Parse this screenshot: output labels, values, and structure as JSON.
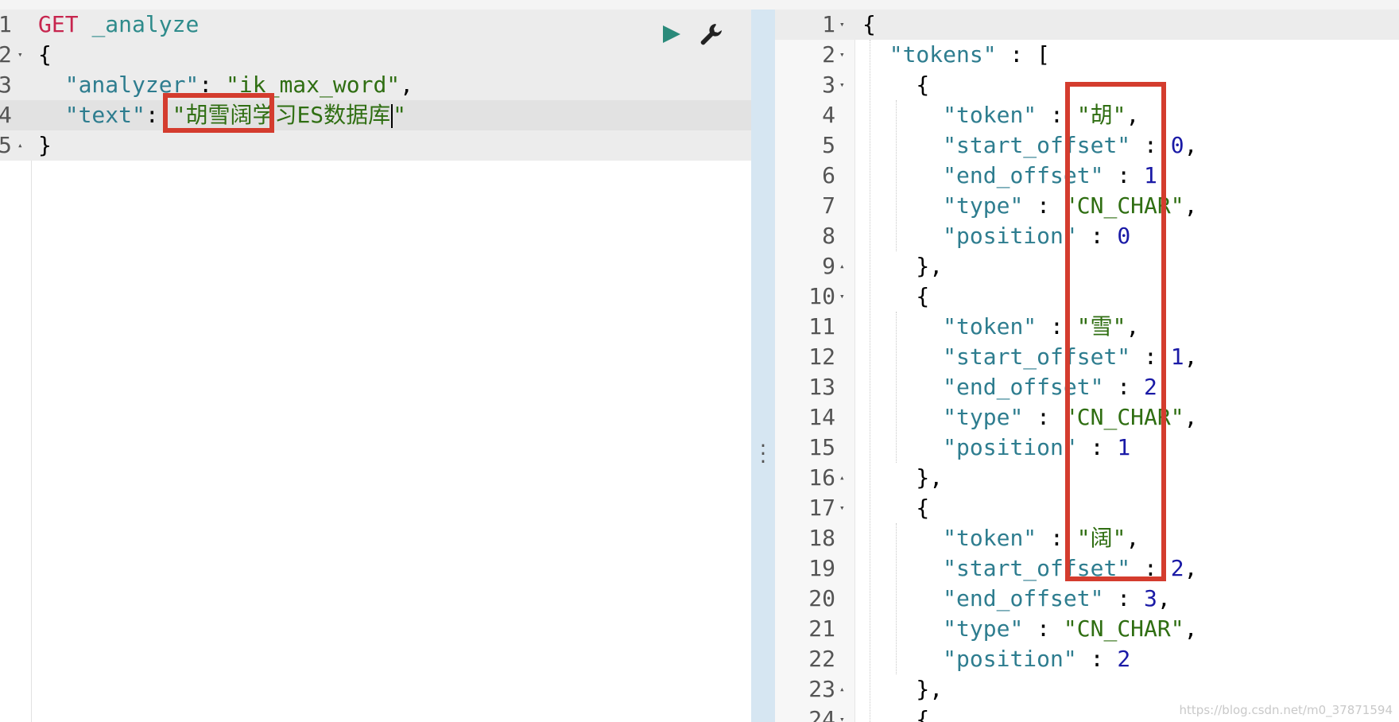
{
  "colors": {
    "method": "#c7254e",
    "url": "#2e8b8b",
    "key": "#2e7d8f",
    "string": "#2f6e12",
    "number": "#1a1aa6",
    "highlight_box": "#d43c2e",
    "run_button": "#2a8a7a",
    "divider": "#d6e6f2"
  },
  "request": {
    "actions": {
      "run_icon": "play-triangle",
      "settings_icon": "wrench"
    },
    "lines": [
      {
        "num": "1",
        "fold": "",
        "tokens": [
          {
            "t": "GET",
            "c": "method"
          },
          {
            "t": " ",
            "c": "pun"
          },
          {
            "t": "_analyze",
            "c": "url"
          }
        ]
      },
      {
        "num": "2",
        "fold": "▾",
        "tokens": [
          {
            "t": "{",
            "c": "pun"
          }
        ]
      },
      {
        "num": "3",
        "fold": "",
        "tokens": [
          {
            "t": "  ",
            "c": "pun"
          },
          {
            "t": "\"analyzer\"",
            "c": "key"
          },
          {
            "t": ": ",
            "c": "pun"
          },
          {
            "t": "\"ik_max_word\"",
            "c": "str"
          },
          {
            "t": ",",
            "c": "pun"
          }
        ]
      },
      {
        "num": "4",
        "fold": "",
        "tokens": [
          {
            "t": "  ",
            "c": "pun"
          },
          {
            "t": "\"text\"",
            "c": "key"
          },
          {
            "t": ": ",
            "c": "pun"
          },
          {
            "t": "\"胡雪阔学习ES数据库",
            "c": "str"
          },
          {
            "t": "\"",
            "c": "str"
          }
        ]
      },
      {
        "num": "5",
        "fold": "▴",
        "tokens": [
          {
            "t": "}",
            "c": "pun"
          }
        ]
      }
    ]
  },
  "response": {
    "lines": [
      {
        "num": "1",
        "fold": "▾",
        "tokens": [
          {
            "t": "{",
            "c": "pun"
          }
        ]
      },
      {
        "num": "2",
        "fold": "▾",
        "tokens": [
          {
            "t": "  ",
            "c": "pun"
          },
          {
            "t": "\"tokens\"",
            "c": "key"
          },
          {
            "t": " : [",
            "c": "pun"
          }
        ]
      },
      {
        "num": "3",
        "fold": "▾",
        "tokens": [
          {
            "t": "    {",
            "c": "pun"
          }
        ]
      },
      {
        "num": "4",
        "fold": "",
        "tokens": [
          {
            "t": "      ",
            "c": "pun"
          },
          {
            "t": "\"token\"",
            "c": "key"
          },
          {
            "t": " : ",
            "c": "pun"
          },
          {
            "t": "\"胡\"",
            "c": "str"
          },
          {
            "t": ",",
            "c": "pun"
          }
        ]
      },
      {
        "num": "5",
        "fold": "",
        "tokens": [
          {
            "t": "      ",
            "c": "pun"
          },
          {
            "t": "\"start_offset\"",
            "c": "key"
          },
          {
            "t": " : ",
            "c": "pun"
          },
          {
            "t": "0",
            "c": "num"
          },
          {
            "t": ",",
            "c": "pun"
          }
        ]
      },
      {
        "num": "6",
        "fold": "",
        "tokens": [
          {
            "t": "      ",
            "c": "pun"
          },
          {
            "t": "\"end_offset\"",
            "c": "key"
          },
          {
            "t": " : ",
            "c": "pun"
          },
          {
            "t": "1",
            "c": "num"
          },
          {
            "t": ",",
            "c": "pun"
          }
        ]
      },
      {
        "num": "7",
        "fold": "",
        "tokens": [
          {
            "t": "      ",
            "c": "pun"
          },
          {
            "t": "\"type\"",
            "c": "key"
          },
          {
            "t": " : ",
            "c": "pun"
          },
          {
            "t": "\"CN_CHAR\"",
            "c": "str"
          },
          {
            "t": ",",
            "c": "pun"
          }
        ]
      },
      {
        "num": "8",
        "fold": "",
        "tokens": [
          {
            "t": "      ",
            "c": "pun"
          },
          {
            "t": "\"position\"",
            "c": "key"
          },
          {
            "t": " : ",
            "c": "pun"
          },
          {
            "t": "0",
            "c": "num"
          }
        ]
      },
      {
        "num": "9",
        "fold": "▴",
        "tokens": [
          {
            "t": "    },",
            "c": "pun"
          }
        ]
      },
      {
        "num": "10",
        "fold": "▾",
        "tokens": [
          {
            "t": "    {",
            "c": "pun"
          }
        ]
      },
      {
        "num": "11",
        "fold": "",
        "tokens": [
          {
            "t": "      ",
            "c": "pun"
          },
          {
            "t": "\"token\"",
            "c": "key"
          },
          {
            "t": " : ",
            "c": "pun"
          },
          {
            "t": "\"雪\"",
            "c": "str"
          },
          {
            "t": ",",
            "c": "pun"
          }
        ]
      },
      {
        "num": "12",
        "fold": "",
        "tokens": [
          {
            "t": "      ",
            "c": "pun"
          },
          {
            "t": "\"start_offset\"",
            "c": "key"
          },
          {
            "t": " : ",
            "c": "pun"
          },
          {
            "t": "1",
            "c": "num"
          },
          {
            "t": ",",
            "c": "pun"
          }
        ]
      },
      {
        "num": "13",
        "fold": "",
        "tokens": [
          {
            "t": "      ",
            "c": "pun"
          },
          {
            "t": "\"end_offset\"",
            "c": "key"
          },
          {
            "t": " : ",
            "c": "pun"
          },
          {
            "t": "2",
            "c": "num"
          },
          {
            "t": ",",
            "c": "pun"
          }
        ]
      },
      {
        "num": "14",
        "fold": "",
        "tokens": [
          {
            "t": "      ",
            "c": "pun"
          },
          {
            "t": "\"type\"",
            "c": "key"
          },
          {
            "t": " : ",
            "c": "pun"
          },
          {
            "t": "\"CN_CHAR\"",
            "c": "str"
          },
          {
            "t": ",",
            "c": "pun"
          }
        ]
      },
      {
        "num": "15",
        "fold": "",
        "tokens": [
          {
            "t": "      ",
            "c": "pun"
          },
          {
            "t": "\"position\"",
            "c": "key"
          },
          {
            "t": " : ",
            "c": "pun"
          },
          {
            "t": "1",
            "c": "num"
          }
        ]
      },
      {
        "num": "16",
        "fold": "▴",
        "tokens": [
          {
            "t": "    },",
            "c": "pun"
          }
        ]
      },
      {
        "num": "17",
        "fold": "▾",
        "tokens": [
          {
            "t": "    {",
            "c": "pun"
          }
        ]
      },
      {
        "num": "18",
        "fold": "",
        "tokens": [
          {
            "t": "      ",
            "c": "pun"
          },
          {
            "t": "\"token\"",
            "c": "key"
          },
          {
            "t": " : ",
            "c": "pun"
          },
          {
            "t": "\"阔\"",
            "c": "str"
          },
          {
            "t": ",",
            "c": "pun"
          }
        ]
      },
      {
        "num": "19",
        "fold": "",
        "tokens": [
          {
            "t": "      ",
            "c": "pun"
          },
          {
            "t": "\"start_offset\"",
            "c": "key"
          },
          {
            "t": " : ",
            "c": "pun"
          },
          {
            "t": "2",
            "c": "num"
          },
          {
            "t": ",",
            "c": "pun"
          }
        ]
      },
      {
        "num": "20",
        "fold": "",
        "tokens": [
          {
            "t": "      ",
            "c": "pun"
          },
          {
            "t": "\"end_offset\"",
            "c": "key"
          },
          {
            "t": " : ",
            "c": "pun"
          },
          {
            "t": "3",
            "c": "num"
          },
          {
            "t": ",",
            "c": "pun"
          }
        ]
      },
      {
        "num": "21",
        "fold": "",
        "tokens": [
          {
            "t": "      ",
            "c": "pun"
          },
          {
            "t": "\"type\"",
            "c": "key"
          },
          {
            "t": " : ",
            "c": "pun"
          },
          {
            "t": "\"CN_CHAR\"",
            "c": "str"
          },
          {
            "t": ",",
            "c": "pun"
          }
        ]
      },
      {
        "num": "22",
        "fold": "",
        "tokens": [
          {
            "t": "      ",
            "c": "pun"
          },
          {
            "t": "\"position\"",
            "c": "key"
          },
          {
            "t": " : ",
            "c": "pun"
          },
          {
            "t": "2",
            "c": "num"
          }
        ]
      },
      {
        "num": "23",
        "fold": "▴",
        "tokens": [
          {
            "t": "    },",
            "c": "pun"
          }
        ]
      },
      {
        "num": "24",
        "fold": "▾",
        "tokens": [
          {
            "t": "    {",
            "c": "pun"
          }
        ]
      }
    ]
  },
  "watermark": "https://blog.csdn.net/m0_37871594"
}
